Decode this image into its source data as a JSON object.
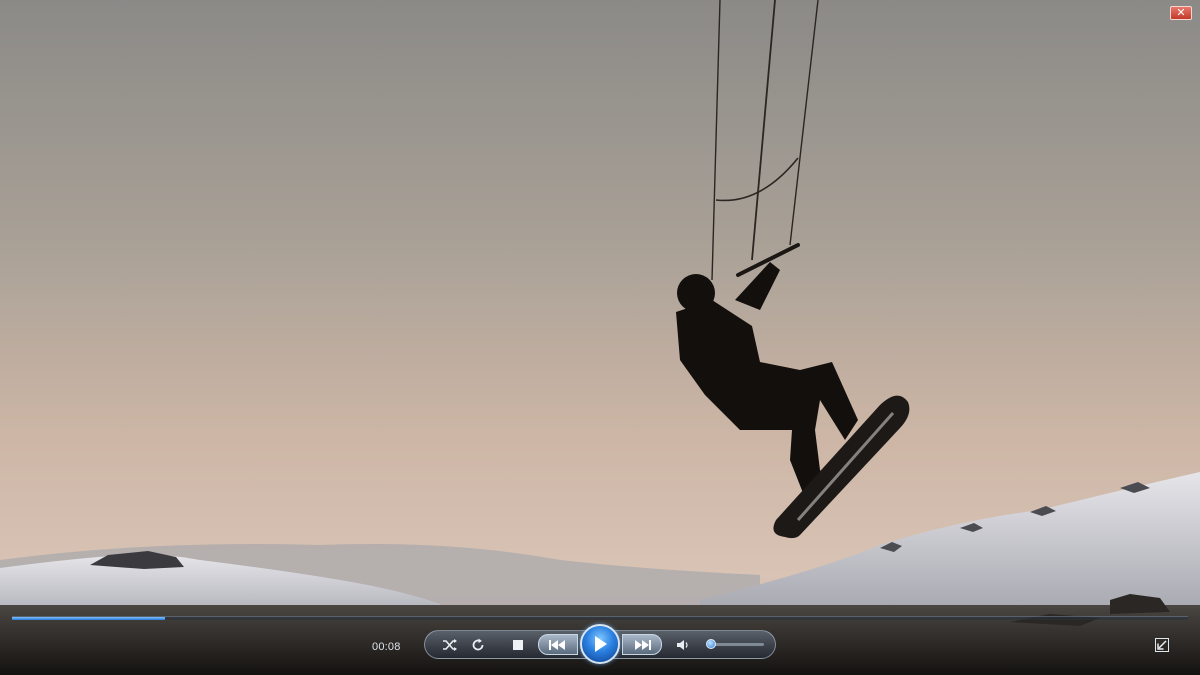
{
  "window": {
    "close_glyph": "✕"
  },
  "player": {
    "elapsed_time": "00:08",
    "seek_progress": 0.13,
    "volume_level": 0.06,
    "state": "paused"
  },
  "icons": {
    "close": "close-icon",
    "shuffle": "shuffle-icon",
    "repeat": "repeat-icon",
    "stop": "stop-icon",
    "previous": "previous-icon",
    "play": "play-icon",
    "next": "next-icon",
    "volume": "speaker-icon",
    "fullscreen": "exit-fullscreen-icon"
  },
  "colors": {
    "sky_top": "#8c8a86",
    "sky_bottom": "#dcc1ae",
    "accent": "#2a7fe0"
  }
}
